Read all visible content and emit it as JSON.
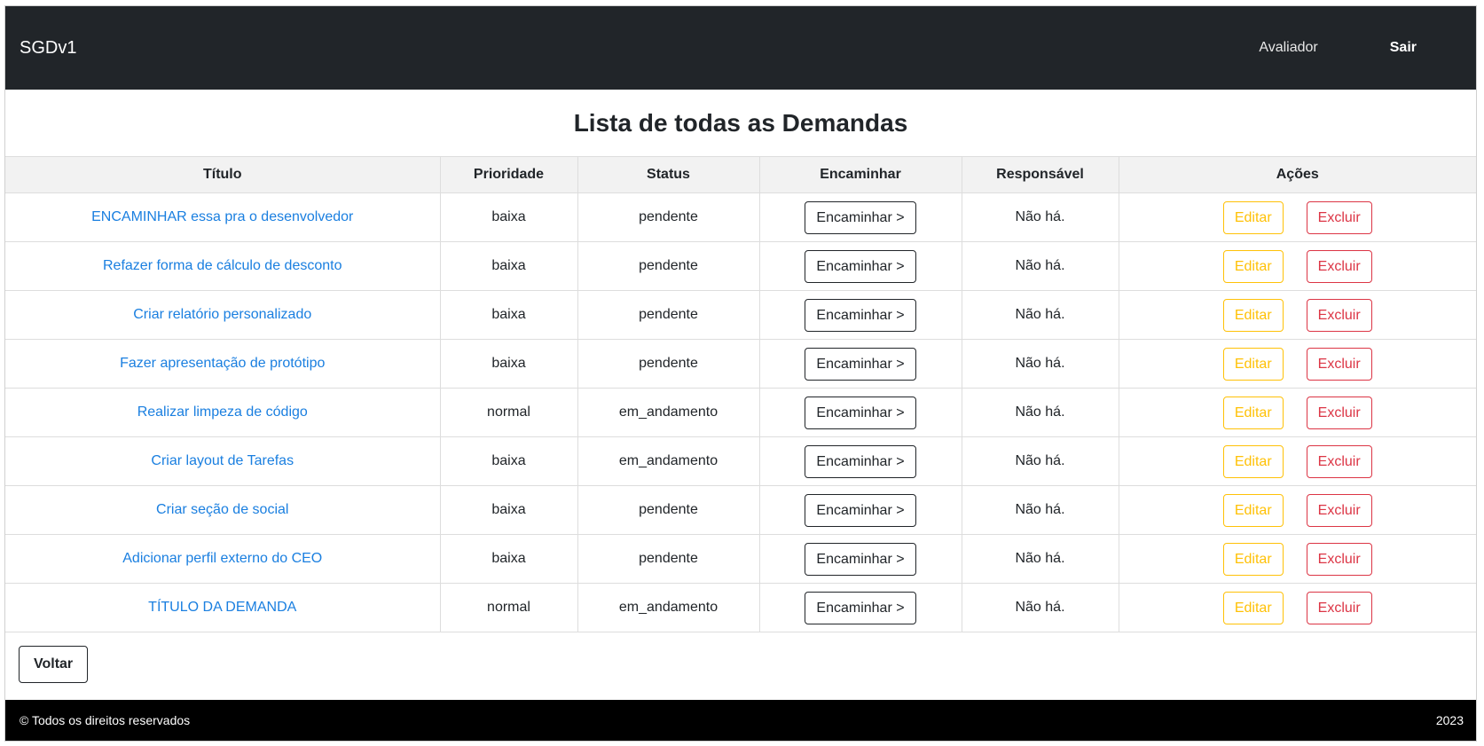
{
  "navbar": {
    "brand": "SGDv1",
    "role": "Avaliador",
    "logout": "Sair"
  },
  "page": {
    "title": "Lista de todas as Demandas"
  },
  "table": {
    "headers": [
      "Título",
      "Prioridade",
      "Status",
      "Encaminhar",
      "Responsável",
      "Ações"
    ],
    "forward_label": "Encaminhar >",
    "edit_label": "Editar",
    "delete_label": "Excluir",
    "rows": [
      {
        "title": "ENCAMINHAR essa pra o desenvolvedor",
        "priority": "baixa",
        "status": "pendente",
        "responsible": "Não há."
      },
      {
        "title": "Refazer forma de cálculo de desconto",
        "priority": "baixa",
        "status": "pendente",
        "responsible": "Não há."
      },
      {
        "title": "Criar relatório personalizado",
        "priority": "baixa",
        "status": "pendente",
        "responsible": "Não há."
      },
      {
        "title": "Fazer apresentação de protótipo",
        "priority": "baixa",
        "status": "pendente",
        "responsible": "Não há."
      },
      {
        "title": "Realizar limpeza de código",
        "priority": "normal",
        "status": "em_andamento",
        "responsible": "Não há."
      },
      {
        "title": "Criar layout de Tarefas",
        "priority": "baixa",
        "status": "em_andamento",
        "responsible": "Não há."
      },
      {
        "title": "Criar seção de social",
        "priority": "baixa",
        "status": "pendente",
        "responsible": "Não há."
      },
      {
        "title": "Adicionar perfil externo do CEO",
        "priority": "baixa",
        "status": "pendente",
        "responsible": "Não há."
      },
      {
        "title": "TÍTULO DA DEMANDA",
        "priority": "normal",
        "status": "em_andamento",
        "responsible": "Não há."
      }
    ]
  },
  "back_button": "Voltar",
  "footer": {
    "copyright": "© Todos os direitos reservados",
    "year": "2023"
  },
  "colors": {
    "navbar_bg": "#212529",
    "link": "#1a7fe0",
    "edit": "#ffc107",
    "delete": "#dc3545",
    "footer_bg": "#000000"
  }
}
